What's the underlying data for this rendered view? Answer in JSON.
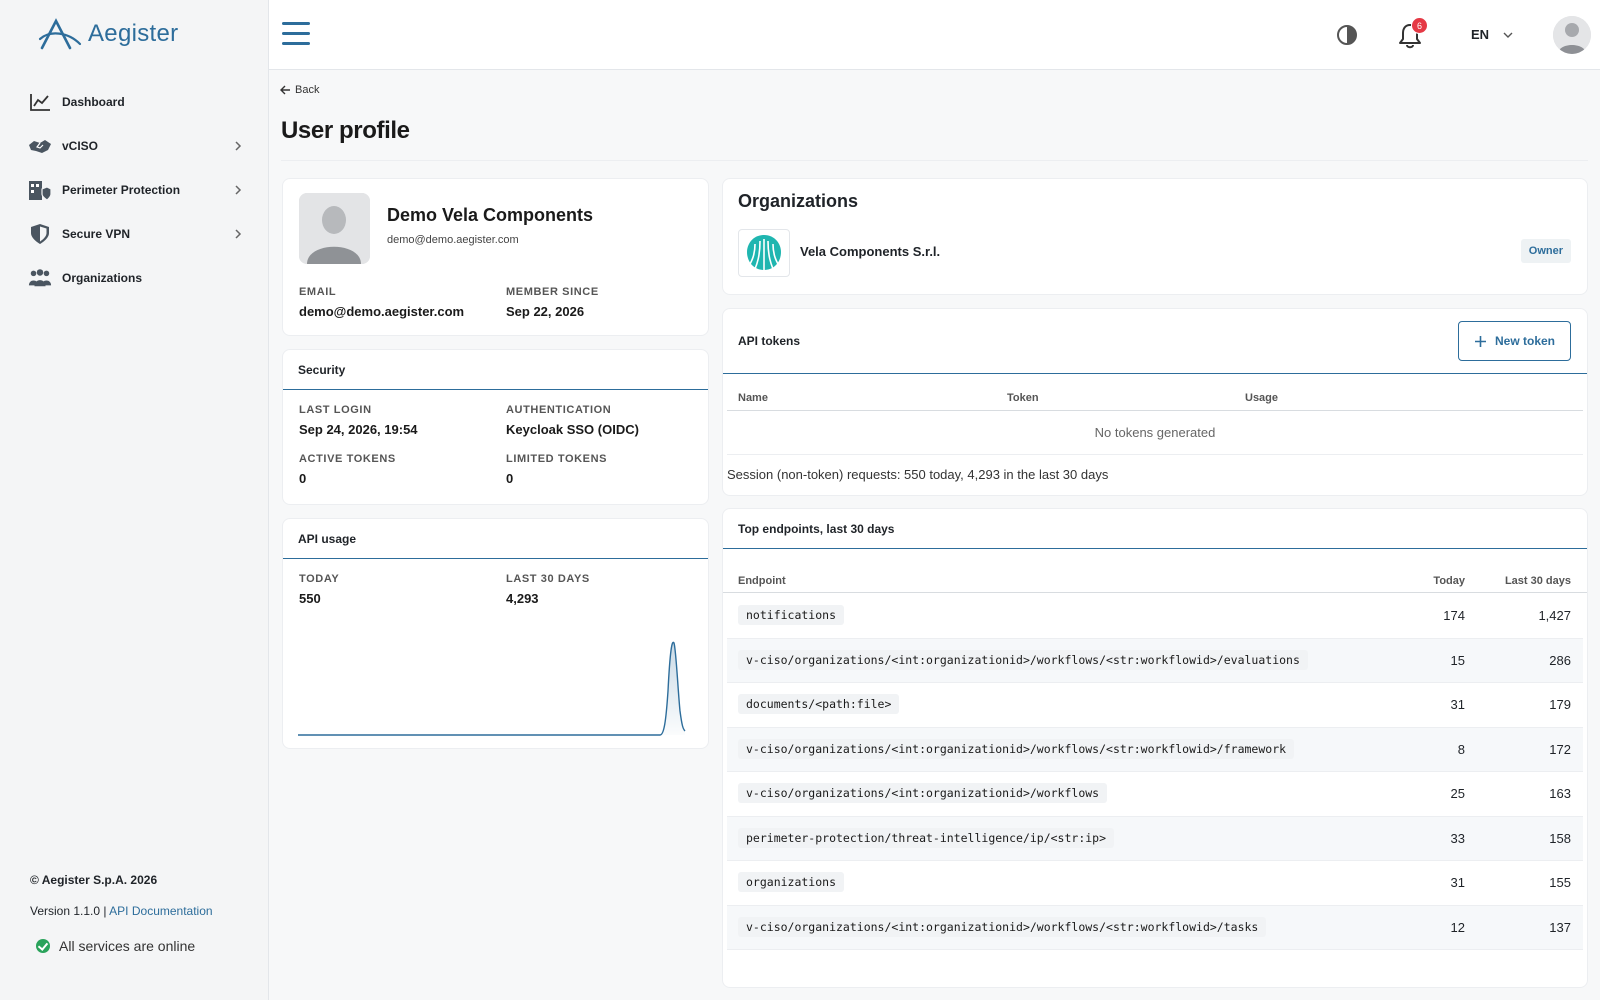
{
  "brand": {
    "name": "Aegister",
    "accent": "#2d6d9b"
  },
  "sidebar": {
    "items": [
      {
        "label": "Dashboard",
        "icon": "chart-line-icon",
        "has_submenu": false
      },
      {
        "label": "vCISO",
        "icon": "handshake-icon",
        "has_submenu": true
      },
      {
        "label": "Perimeter Protection",
        "icon": "building-shield-icon",
        "has_submenu": true
      },
      {
        "label": "Secure VPN",
        "icon": "shield-icon",
        "has_submenu": true
      },
      {
        "label": "Organizations",
        "icon": "users-icon",
        "has_submenu": false
      }
    ],
    "footer": {
      "copyright": "© Aegister S.p.A. 2026",
      "version": "Version 1.1.0 | ",
      "docs_link": "API Documentation",
      "status": "All services are online"
    }
  },
  "header": {
    "notifications_count": "6",
    "language": "EN"
  },
  "page": {
    "back_label": "Back",
    "title": "User profile"
  },
  "profile": {
    "name": "Demo Vela Components",
    "email_small": "demo@demo.aegister.com",
    "email_label": "EMAIL",
    "email": "demo@demo.aegister.com",
    "member_since_label": "MEMBER SINCE",
    "member_since": "Sep 22, 2026"
  },
  "security": {
    "title": "Security",
    "last_login_label": "LAST LOGIN",
    "last_login": "Sep 24, 2026, 19:54",
    "auth_label": "AUTHENTICATION",
    "auth": "Keycloak SSO (OIDC)",
    "active_tokens_label": "ACTIVE TOKENS",
    "active_tokens": "0",
    "limited_tokens_label": "LIMITED TOKENS",
    "limited_tokens": "0"
  },
  "api_usage": {
    "title": "API usage",
    "today_label": "TODAY",
    "today": "550",
    "last30_label": "LAST 30 DAYS",
    "last30": "4,293",
    "sparkline_color": "#2d6d9b"
  },
  "organizations": {
    "title": "Organizations",
    "items": [
      {
        "name": "Vela Components S.r.l.",
        "role": "Owner"
      }
    ]
  },
  "tokens": {
    "title": "API tokens",
    "new_button": "New token",
    "columns": [
      "Name",
      "Token",
      "Usage"
    ],
    "empty_text": "No tokens generated",
    "session_note": "Session (non-token) requests: 550 today, 4,293 in the last 30 days"
  },
  "endpoints": {
    "title": "Top endpoints, last 30 days",
    "columns": {
      "endpoint": "Endpoint",
      "today": "Today",
      "last30": "Last 30 days"
    },
    "rows": [
      {
        "path": "notifications",
        "today": "174",
        "last30": "1,427"
      },
      {
        "path": "v-ciso/organizations/<int:organizationid>/workflows/<str:workflowid>/evaluations",
        "today": "15",
        "last30": "286"
      },
      {
        "path": "documents/<path:file>",
        "today": "31",
        "last30": "179"
      },
      {
        "path": "v-ciso/organizations/<int:organizationid>/workflows/<str:workflowid>/framework",
        "today": "8",
        "last30": "172"
      },
      {
        "path": "v-ciso/organizations/<int:organizationid>/workflows",
        "today": "25",
        "last30": "163"
      },
      {
        "path": "perimeter-protection/threat-intelligence/ip/<str:ip>",
        "today": "33",
        "last30": "158"
      },
      {
        "path": "organizations",
        "today": "31",
        "last30": "155"
      },
      {
        "path": "v-ciso/organizations/<int:organizationid>/workflows/<str:workflowid>/tasks",
        "today": "12",
        "last30": "137"
      }
    ]
  }
}
